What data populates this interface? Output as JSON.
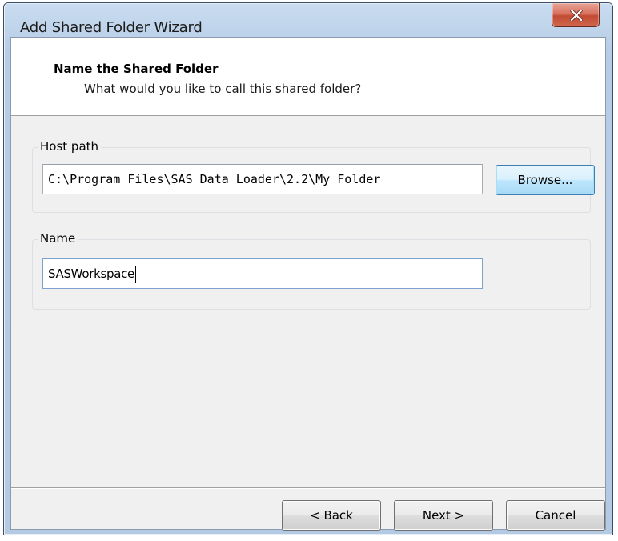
{
  "window": {
    "title": "Add Shared Folder Wizard"
  },
  "header": {
    "title": "Name the Shared Folder",
    "subtitle": "What would you like to call this shared folder?"
  },
  "host_path": {
    "group_label": "Host path",
    "value": "C:\\Program Files\\SAS Data Loader\\2.2\\My Folder",
    "browse_label": "Browse..."
  },
  "name": {
    "group_label": "Name",
    "value": "SASWorkspace"
  },
  "footer": {
    "back_label": "< Back",
    "next_label": "Next >",
    "cancel_label": "Cancel"
  }
}
